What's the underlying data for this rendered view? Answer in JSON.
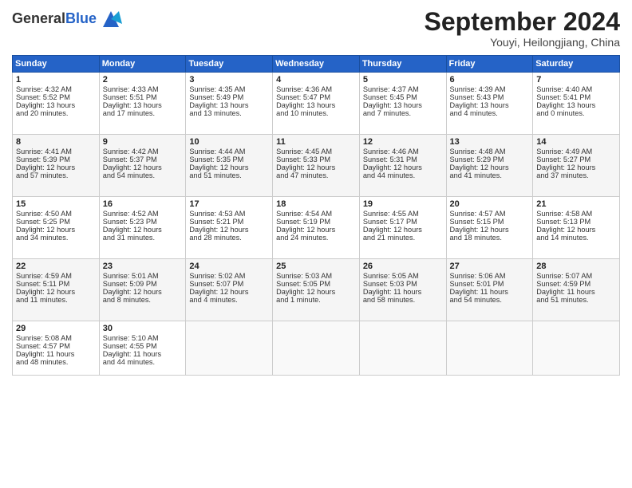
{
  "header": {
    "logo_general": "General",
    "logo_blue": "Blue",
    "month": "September 2024",
    "location": "Youyi, Heilongjiang, China"
  },
  "weekdays": [
    "Sunday",
    "Monday",
    "Tuesday",
    "Wednesday",
    "Thursday",
    "Friday",
    "Saturday"
  ],
  "weeks": [
    [
      {
        "day": "1",
        "lines": [
          "Sunrise: 4:32 AM",
          "Sunset: 5:52 PM",
          "Daylight: 13 hours",
          "and 20 minutes."
        ]
      },
      {
        "day": "2",
        "lines": [
          "Sunrise: 4:33 AM",
          "Sunset: 5:51 PM",
          "Daylight: 13 hours",
          "and 17 minutes."
        ]
      },
      {
        "day": "3",
        "lines": [
          "Sunrise: 4:35 AM",
          "Sunset: 5:49 PM",
          "Daylight: 13 hours",
          "and 13 minutes."
        ]
      },
      {
        "day": "4",
        "lines": [
          "Sunrise: 4:36 AM",
          "Sunset: 5:47 PM",
          "Daylight: 13 hours",
          "and 10 minutes."
        ]
      },
      {
        "day": "5",
        "lines": [
          "Sunrise: 4:37 AM",
          "Sunset: 5:45 PM",
          "Daylight: 13 hours",
          "and 7 minutes."
        ]
      },
      {
        "day": "6",
        "lines": [
          "Sunrise: 4:39 AM",
          "Sunset: 5:43 PM",
          "Daylight: 13 hours",
          "and 4 minutes."
        ]
      },
      {
        "day": "7",
        "lines": [
          "Sunrise: 4:40 AM",
          "Sunset: 5:41 PM",
          "Daylight: 13 hours",
          "and 0 minutes."
        ]
      }
    ],
    [
      {
        "day": "8",
        "lines": [
          "Sunrise: 4:41 AM",
          "Sunset: 5:39 PM",
          "Daylight: 12 hours",
          "and 57 minutes."
        ]
      },
      {
        "day": "9",
        "lines": [
          "Sunrise: 4:42 AM",
          "Sunset: 5:37 PM",
          "Daylight: 12 hours",
          "and 54 minutes."
        ]
      },
      {
        "day": "10",
        "lines": [
          "Sunrise: 4:44 AM",
          "Sunset: 5:35 PM",
          "Daylight: 12 hours",
          "and 51 minutes."
        ]
      },
      {
        "day": "11",
        "lines": [
          "Sunrise: 4:45 AM",
          "Sunset: 5:33 PM",
          "Daylight: 12 hours",
          "and 47 minutes."
        ]
      },
      {
        "day": "12",
        "lines": [
          "Sunrise: 4:46 AM",
          "Sunset: 5:31 PM",
          "Daylight: 12 hours",
          "and 44 minutes."
        ]
      },
      {
        "day": "13",
        "lines": [
          "Sunrise: 4:48 AM",
          "Sunset: 5:29 PM",
          "Daylight: 12 hours",
          "and 41 minutes."
        ]
      },
      {
        "day": "14",
        "lines": [
          "Sunrise: 4:49 AM",
          "Sunset: 5:27 PM",
          "Daylight: 12 hours",
          "and 37 minutes."
        ]
      }
    ],
    [
      {
        "day": "15",
        "lines": [
          "Sunrise: 4:50 AM",
          "Sunset: 5:25 PM",
          "Daylight: 12 hours",
          "and 34 minutes."
        ]
      },
      {
        "day": "16",
        "lines": [
          "Sunrise: 4:52 AM",
          "Sunset: 5:23 PM",
          "Daylight: 12 hours",
          "and 31 minutes."
        ]
      },
      {
        "day": "17",
        "lines": [
          "Sunrise: 4:53 AM",
          "Sunset: 5:21 PM",
          "Daylight: 12 hours",
          "and 28 minutes."
        ]
      },
      {
        "day": "18",
        "lines": [
          "Sunrise: 4:54 AM",
          "Sunset: 5:19 PM",
          "Daylight: 12 hours",
          "and 24 minutes."
        ]
      },
      {
        "day": "19",
        "lines": [
          "Sunrise: 4:55 AM",
          "Sunset: 5:17 PM",
          "Daylight: 12 hours",
          "and 21 minutes."
        ]
      },
      {
        "day": "20",
        "lines": [
          "Sunrise: 4:57 AM",
          "Sunset: 5:15 PM",
          "Daylight: 12 hours",
          "and 18 minutes."
        ]
      },
      {
        "day": "21",
        "lines": [
          "Sunrise: 4:58 AM",
          "Sunset: 5:13 PM",
          "Daylight: 12 hours",
          "and 14 minutes."
        ]
      }
    ],
    [
      {
        "day": "22",
        "lines": [
          "Sunrise: 4:59 AM",
          "Sunset: 5:11 PM",
          "Daylight: 12 hours",
          "and 11 minutes."
        ]
      },
      {
        "day": "23",
        "lines": [
          "Sunrise: 5:01 AM",
          "Sunset: 5:09 PM",
          "Daylight: 12 hours",
          "and 8 minutes."
        ]
      },
      {
        "day": "24",
        "lines": [
          "Sunrise: 5:02 AM",
          "Sunset: 5:07 PM",
          "Daylight: 12 hours",
          "and 4 minutes."
        ]
      },
      {
        "day": "25",
        "lines": [
          "Sunrise: 5:03 AM",
          "Sunset: 5:05 PM",
          "Daylight: 12 hours",
          "and 1 minute."
        ]
      },
      {
        "day": "26",
        "lines": [
          "Sunrise: 5:05 AM",
          "Sunset: 5:03 PM",
          "Daylight: 11 hours",
          "and 58 minutes."
        ]
      },
      {
        "day": "27",
        "lines": [
          "Sunrise: 5:06 AM",
          "Sunset: 5:01 PM",
          "Daylight: 11 hours",
          "and 54 minutes."
        ]
      },
      {
        "day": "28",
        "lines": [
          "Sunrise: 5:07 AM",
          "Sunset: 4:59 PM",
          "Daylight: 11 hours",
          "and 51 minutes."
        ]
      }
    ],
    [
      {
        "day": "29",
        "lines": [
          "Sunrise: 5:08 AM",
          "Sunset: 4:57 PM",
          "Daylight: 11 hours",
          "and 48 minutes."
        ]
      },
      {
        "day": "30",
        "lines": [
          "Sunrise: 5:10 AM",
          "Sunset: 4:55 PM",
          "Daylight: 11 hours",
          "and 44 minutes."
        ]
      },
      {
        "day": "",
        "lines": []
      },
      {
        "day": "",
        "lines": []
      },
      {
        "day": "",
        "lines": []
      },
      {
        "day": "",
        "lines": []
      },
      {
        "day": "",
        "lines": []
      }
    ]
  ]
}
